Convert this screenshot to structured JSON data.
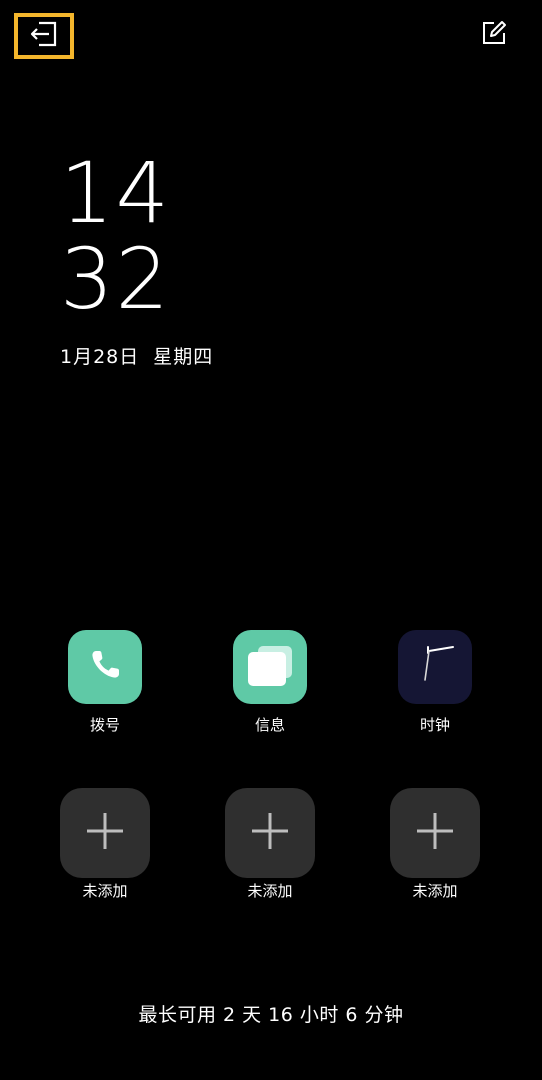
{
  "header": {
    "exit_icon": "exit-icon",
    "edit_icon": "edit-icon",
    "highlight_color": "#f4b62c"
  },
  "clock": {
    "hour": "14",
    "minute": "32"
  },
  "date": {
    "day": "1月28日",
    "weekday": "星期四"
  },
  "apps": [
    {
      "label": "拨号",
      "icon": "phone-icon",
      "color": "#5fc9a6"
    },
    {
      "label": "信息",
      "icon": "message-icon",
      "color": "#5fc9a6"
    },
    {
      "label": "时钟",
      "icon": "clock-icon",
      "color": "#151634"
    }
  ],
  "slots": [
    {
      "label": "未添加",
      "icon": "plus-icon"
    },
    {
      "label": "未添加",
      "icon": "plus-icon"
    },
    {
      "label": "未添加",
      "icon": "plus-icon"
    }
  ],
  "battery": {
    "text": "最长可用 2 天 16 小时 6 分钟"
  }
}
